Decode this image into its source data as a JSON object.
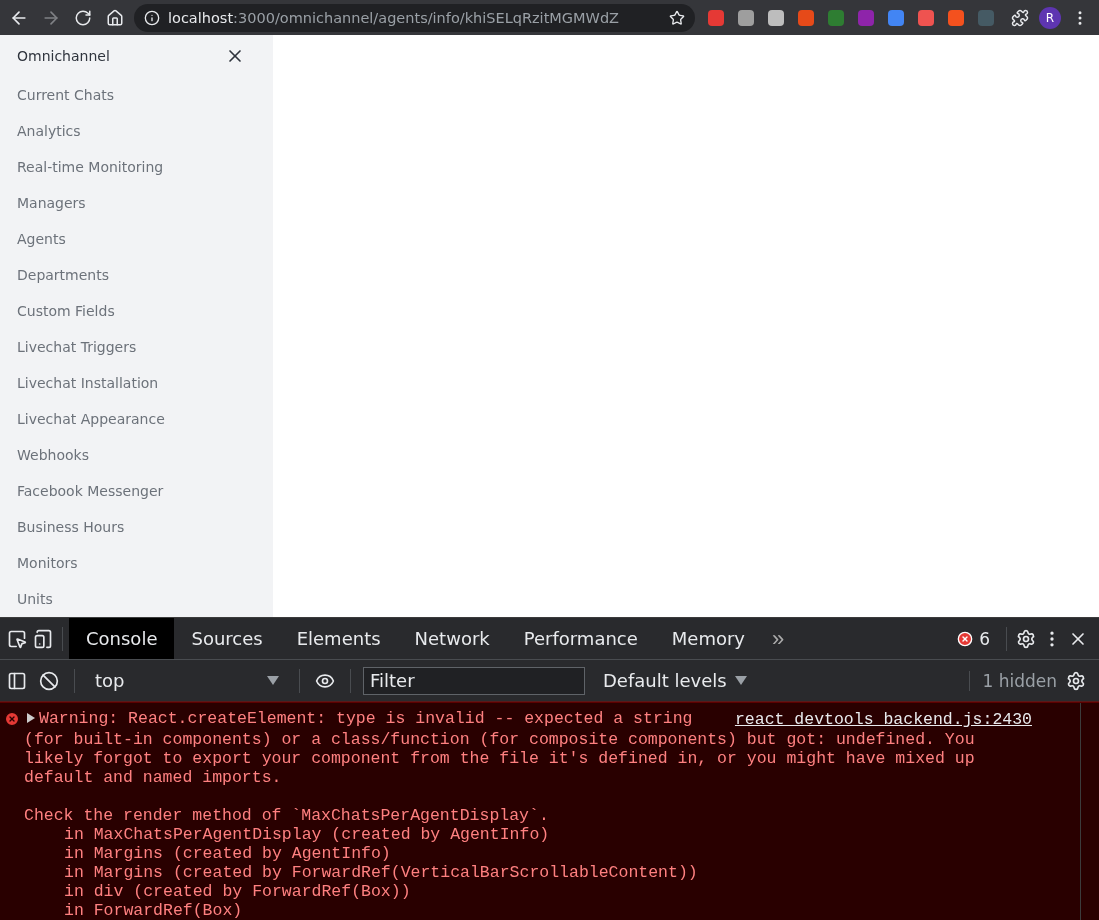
{
  "browser": {
    "url_host": "localhost",
    "url_path": ":3000/omnichannel/agents/info/khiSELqRzitMGMWdZ",
    "avatar_letter": "R",
    "extensions": [
      {
        "color": "#e53935"
      },
      {
        "color": "#9e9e9e"
      },
      {
        "color": "#bdbdbd"
      },
      {
        "color": "#e64a19"
      },
      {
        "color": "#2e7d32"
      },
      {
        "color": "#8e24aa"
      },
      {
        "color": "#4285f4"
      },
      {
        "color": "#ef5350"
      },
      {
        "color": "#f4511e"
      },
      {
        "color": "#455a64"
      }
    ]
  },
  "sidebar": {
    "title": "Omnichannel",
    "items": [
      "Current Chats",
      "Analytics",
      "Real-time Monitoring",
      "Managers",
      "Agents",
      "Departments",
      "Custom Fields",
      "Livechat Triggers",
      "Livechat Installation",
      "Livechat Appearance",
      "Webhooks",
      "Facebook Messenger",
      "Business Hours",
      "Monitors",
      "Units"
    ]
  },
  "devtools": {
    "tabs": [
      {
        "label": "Console",
        "selected": true
      },
      {
        "label": "Sources",
        "selected": false
      },
      {
        "label": "Elements",
        "selected": false
      },
      {
        "label": "Network",
        "selected": false
      },
      {
        "label": "Performance",
        "selected": false
      },
      {
        "label": "Memory",
        "selected": false
      }
    ],
    "more_tabs": "»",
    "error_count": "6",
    "console_toolbar": {
      "context": "top",
      "filter_placeholder": "Filter",
      "levels": "Default levels",
      "hidden": "1 hidden"
    },
    "messages": [
      {
        "kind": "error",
        "expanded": false,
        "source": "react_devtools_backend.js:2430",
        "summary": "Warning: React.createElement: type is invalid -- expected a string",
        "text": "(for built-in components) or a class/function (for composite components) but got: undefined. You likely forgot to export your component from the file it's defined in, or you might have mixed up default and named imports.",
        "check": "Check the render method of `MaxChatsPerAgentDisplay`.",
        "stack": [
          "in MaxChatsPerAgentDisplay (created by AgentInfo)",
          "in Margins (created by AgentInfo)",
          "in Margins (created by ForwardRef(VerticalBarScrollableContent))",
          "in div (created by ForwardRef(Box))",
          "in ForwardRef(Box)"
        ]
      }
    ]
  }
}
